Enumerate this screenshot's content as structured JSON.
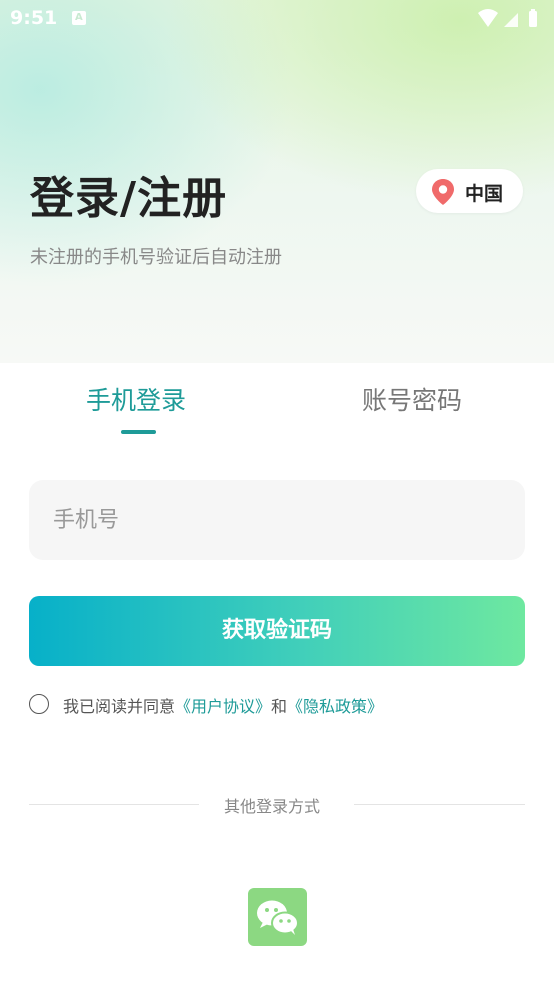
{
  "status_bar": {
    "time": "9:51",
    "notification_icon": "a-icon",
    "icons": [
      "wifi-icon",
      "signal-icon",
      "battery-icon"
    ]
  },
  "header": {
    "title": "登录/注册",
    "subtitle": "未注册的手机号验证后自动注册",
    "region": {
      "icon": "location-pin-icon",
      "label": "中国"
    }
  },
  "tabs": [
    {
      "label": "手机登录",
      "active": true
    },
    {
      "label": "账号密码",
      "active": false
    }
  ],
  "form": {
    "phone": {
      "placeholder": "手机号",
      "value": ""
    },
    "submit_label": "获取验证码"
  },
  "agreement": {
    "checked": false,
    "prefix": "我已阅读并同意",
    "user_agreement": "《用户协议》",
    "conjunction": "和",
    "privacy_policy": "《隐私政策》"
  },
  "other_login": {
    "label": "其他登录方式",
    "methods": [
      {
        "icon": "wechat-icon"
      }
    ]
  },
  "colors": {
    "accent": "#1e9b98",
    "button_start": "#07b0c9",
    "button_end": "#6ee8a0",
    "wechat": "#8cd882",
    "pin": "#f06a6a"
  }
}
